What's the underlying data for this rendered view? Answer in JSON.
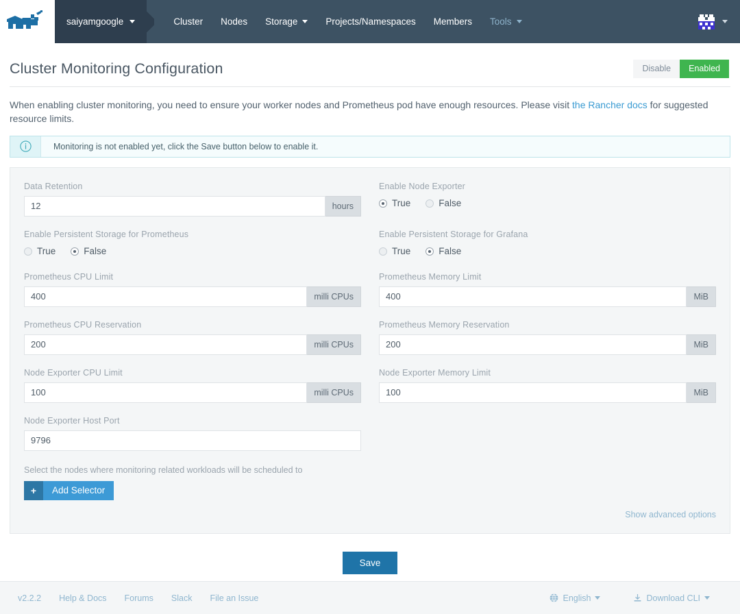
{
  "header": {
    "logo_name": "rancher-logo",
    "cluster_name": "saiyamgoogle",
    "nav": [
      {
        "label": "Cluster",
        "has_caret": false,
        "muted": false
      },
      {
        "label": "Nodes",
        "has_caret": false,
        "muted": false
      },
      {
        "label": "Storage",
        "has_caret": true,
        "muted": false
      },
      {
        "label": "Projects/Namespaces",
        "has_caret": false,
        "muted": false
      },
      {
        "label": "Members",
        "has_caret": false,
        "muted": false
      },
      {
        "label": "Tools",
        "has_caret": true,
        "muted": true
      }
    ],
    "avatar_name": "user-avatar-identicon",
    "colors": {
      "bar": "#3d5263",
      "chip": "#2e3e4e",
      "muted_link": "#8fb4cc"
    }
  },
  "page": {
    "title": "Cluster Monitoring Configuration",
    "toggle": {
      "disable_label": "Disable",
      "enabled_label": "Enabled",
      "active": "Enabled",
      "active_color": "#3fb54f"
    },
    "description_before": "When enabling cluster monitoring, you need to ensure your worker nodes and Prometheus pod have enough resources. Please visit ",
    "description_link": "the Rancher docs",
    "description_after": " for suggested resource limits.",
    "banner": {
      "icon": "info-circle-icon",
      "text": "Monitoring is not enabled yet, click the Save button below to enable it.",
      "color": "#dff4f7"
    }
  },
  "form": {
    "data_retention": {
      "label": "Data Retention",
      "value": "12",
      "suffix": "hours"
    },
    "enable_node_exporter": {
      "label": "Enable Node Exporter",
      "options": [
        "True",
        "False"
      ],
      "selected": "True"
    },
    "persistent_storage_prometheus": {
      "label": "Enable Persistent Storage for Prometheus",
      "options": [
        "True",
        "False"
      ],
      "selected": "False"
    },
    "persistent_storage_grafana": {
      "label": "Enable Persistent Storage for Grafana",
      "options": [
        "True",
        "False"
      ],
      "selected": "False"
    },
    "prometheus_cpu_limit": {
      "label": "Prometheus CPU Limit",
      "value": "400",
      "suffix": "milli CPUs"
    },
    "prometheus_memory_limit": {
      "label": "Prometheus Memory Limit",
      "value": "400",
      "suffix": "MiB"
    },
    "prometheus_cpu_reservation": {
      "label": "Prometheus CPU Reservation",
      "value": "200",
      "suffix": "milli CPUs"
    },
    "prometheus_memory_reservation": {
      "label": "Prometheus Memory Reservation",
      "value": "200",
      "suffix": "MiB"
    },
    "node_exporter_cpu_limit": {
      "label": "Node Exporter CPU Limit",
      "value": "100",
      "suffix": "milli CPUs"
    },
    "node_exporter_memory_limit": {
      "label": "Node Exporter Memory Limit",
      "value": "100",
      "suffix": "MiB"
    },
    "node_exporter_host_port": {
      "label": "Node Exporter Host Port",
      "value": "9796"
    },
    "selector": {
      "note": "Select the nodes where monitoring related workloads will be scheduled to",
      "button_label": "Add Selector",
      "plus_icon": "plus-icon"
    },
    "advanced_link": "Show advanced options"
  },
  "actions": {
    "save_label": "Save",
    "save_color": "#1f74a8"
  },
  "footer": {
    "links": [
      "v2.2.2",
      "Help & Docs",
      "Forums",
      "Slack",
      "File an Issue"
    ],
    "language": {
      "icon": "globe-icon",
      "label": "English"
    },
    "cli": {
      "icon": "download-icon",
      "label": "Download CLI"
    }
  }
}
